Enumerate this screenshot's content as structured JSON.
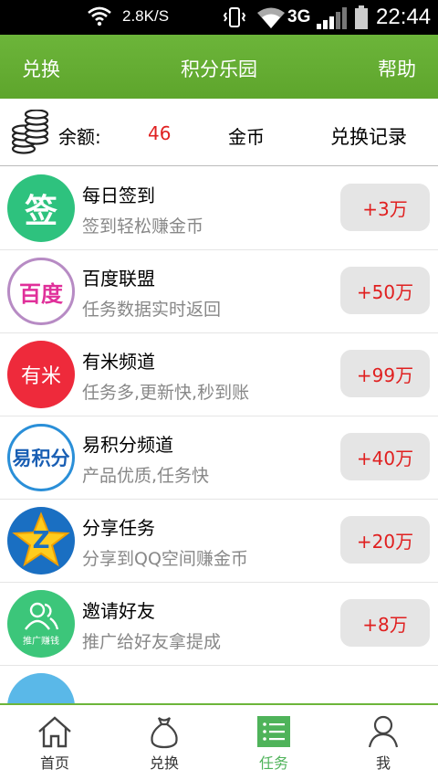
{
  "status_bar": {
    "net_speed": "2.8K/S",
    "network_type": "3G",
    "time": "22:44"
  },
  "header": {
    "left_label": "兑换",
    "title": "积分乐园",
    "right_label": "帮助"
  },
  "balance": {
    "label": "余额:",
    "value": "46",
    "unit": "金币",
    "record_label": "兑换记录"
  },
  "tasks": [
    {
      "icon": "sign-in-icon",
      "icon_text": "签",
      "icon_color": "#2ec27e",
      "name": "每日签到",
      "desc": "签到轻松赚金币",
      "reward": "+3万"
    },
    {
      "icon": "baidu-union-icon",
      "icon_text": "百度",
      "icon_color": "#ffffff",
      "name": "百度联盟",
      "desc": "任务数据实时返回",
      "reward": "+50万"
    },
    {
      "icon": "youmi-icon",
      "icon_text": "有米",
      "icon_color": "#ee2a3b",
      "name": "有米频道",
      "desc": "任务多,更新快,秒到账",
      "reward": "+99万"
    },
    {
      "icon": "yijifen-icon",
      "icon_text": "易积分",
      "icon_color": "#ffffff",
      "name": "易积分频道",
      "desc": "产品优质,任务快",
      "reward": "+40万"
    },
    {
      "icon": "qzone-star-icon",
      "icon_text": "Z",
      "icon_color": "#1a6fc2",
      "name": "分享任务",
      "desc": "分享到QQ空间赚金币",
      "reward": "+20万"
    },
    {
      "icon": "invite-friends-icon",
      "icon_text": "推广赚钱",
      "icon_color": "#3cc67a",
      "name": "邀请好友",
      "desc": "推广给好友拿提成",
      "reward": "+8万"
    }
  ],
  "tabs": [
    {
      "label": "首页",
      "icon": "home-icon"
    },
    {
      "label": "兑换",
      "icon": "money-bag-icon"
    },
    {
      "label": "任务",
      "icon": "task-list-icon"
    },
    {
      "label": "我",
      "icon": "user-icon"
    }
  ],
  "colors": {
    "header_green": "#6cb53a",
    "reward_red": "#e02020",
    "active_tab": "#4fb35a"
  }
}
